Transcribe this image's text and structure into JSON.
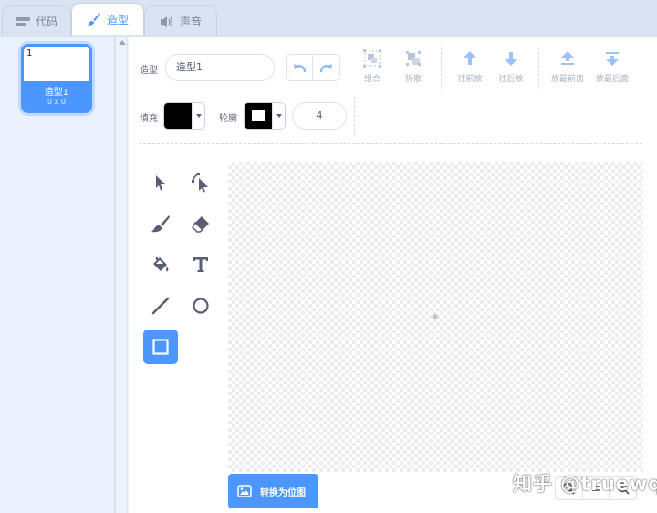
{
  "tabs": [
    {
      "label": "代码",
      "icon": "code-icon"
    },
    {
      "label": "造型",
      "icon": "brush-icon"
    },
    {
      "label": "声音",
      "icon": "speaker-icon"
    }
  ],
  "costumes": [
    {
      "number": "1",
      "name": "造型1",
      "size": "0 x 0"
    }
  ],
  "toolbar": {
    "costume_label": "造型",
    "costume_name": "造型1",
    "group_label": "组合",
    "ungroup_label": "拆散",
    "forward_label": "往前放",
    "backward_label": "往后放",
    "front_label": "放最前面",
    "back_label": "放最后面",
    "fill_label": "填充",
    "outline_label": "轮廓",
    "outline_width": "4",
    "fill_color": "#000000",
    "outline_color": "#000000"
  },
  "tools": [
    {
      "name": "select-tool",
      "icon": "arrow-pointer-icon"
    },
    {
      "name": "reshape-tool",
      "icon": "reshape-pointer-icon"
    },
    {
      "name": "brush-tool",
      "icon": "brush-icon"
    },
    {
      "name": "eraser-tool",
      "icon": "eraser-icon"
    },
    {
      "name": "fill-tool",
      "icon": "paint-bucket-icon"
    },
    {
      "name": "text-tool",
      "icon": "text-t-icon"
    },
    {
      "name": "line-tool",
      "icon": "line-icon"
    },
    {
      "name": "circle-tool",
      "icon": "circle-icon"
    },
    {
      "name": "rectangle-tool",
      "icon": "rectangle-icon",
      "active": true
    }
  ],
  "convert_button": "转换为位图",
  "watermark": "知乎 @truewq",
  "colors": {
    "accent": "#4c97ff",
    "text": "#575e75",
    "disabled": "#a8b2c2"
  }
}
